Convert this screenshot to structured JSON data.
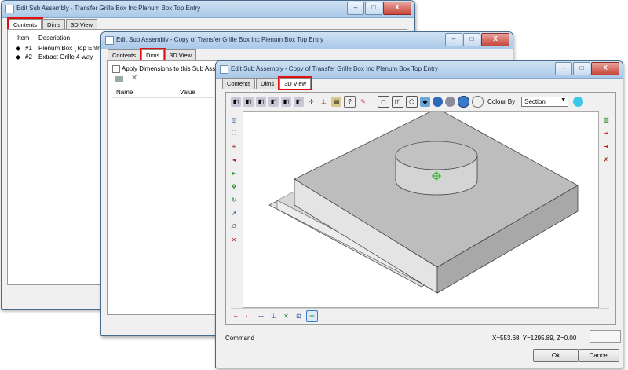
{
  "win1": {
    "title": "Edit Sub Assembly - Transfer Grille Box Inc Plenum Box Top Entry",
    "tabs": [
      "Contents",
      "Dims",
      "3D View"
    ],
    "columns": {
      "item": "Item",
      "description": "Description"
    },
    "rows": [
      {
        "item": "#1",
        "description": "Plenum Box (Top Entry)"
      },
      {
        "item": "#2",
        "description": "Extract Grille 4-way"
      }
    ]
  },
  "win2": {
    "title": "Edit Sub Assembly - Copy of Transfer Grille Box Inc Plenum Box Top Entry",
    "tabs": [
      "Contents",
      "Dims",
      "3D View"
    ],
    "checkbox_label": "Apply Dimensions to this Sub Assembly",
    "columns": {
      "name": "Name",
      "value": "Value"
    }
  },
  "win3": {
    "title": "Edit Sub Assembly - Copy of Transfer Grille Box Inc Plenum Box Top Entry",
    "tabs": [
      "Contents",
      "Dims",
      "3D View"
    ],
    "colour_by_label": "Colour By",
    "colour_by_value": "Section",
    "command_label": "Command",
    "coords": "X=553.68, Y=1295.89, Z=0.00",
    "ok": "Ok",
    "cancel": "Cancel"
  },
  "window_buttons": {
    "minimize": "–",
    "maximize": "□",
    "close": "X"
  },
  "icons": [
    "view-icon",
    "zoom-icon",
    "pan-icon",
    "rotate-icon",
    "delete-icon"
  ],
  "colors": {
    "highlight": "#e01010",
    "titlebar": "#bcd4ee",
    "viewport": "#ffffff",
    "model": "#bdbdbd"
  }
}
